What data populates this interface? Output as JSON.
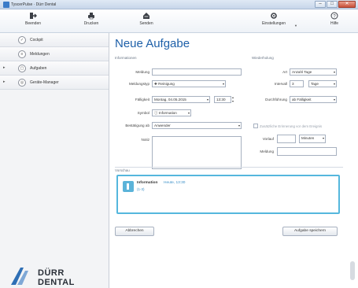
{
  "window": {
    "title": "TyscerPulse · Dürr Dental"
  },
  "toolbar": {
    "beenden": "Beenden",
    "drucken": "Drucken",
    "senden": "Senden",
    "einstellungen": "Einstellungen",
    "hilfe": "Hilfe"
  },
  "sidebar": {
    "items": [
      {
        "label": "Cockpit",
        "expandable": false
      },
      {
        "label": "Meldungen",
        "expandable": false
      },
      {
        "label": "Aufgaben",
        "expandable": true
      },
      {
        "label": "Geräte-Manager",
        "expandable": true
      }
    ]
  },
  "logo": {
    "line1": "DÜRR",
    "line2": "DENTAL"
  },
  "main": {
    "title": "Neue Aufgabe",
    "sections": {
      "info": "Informationen",
      "repeat": "Wiederholung",
      "preview": "Vorschau"
    },
    "form": {
      "meldung_label": "Meldung",
      "meldung_value": "",
      "meldungstyp_label": "Meldungstyp",
      "meldungstyp_value": "✚ Reinigung",
      "faelligkeit_label": "Fälligkeit",
      "faelligkeit_date": "Montag, 04.05.2015",
      "faelligkeit_time": "13:30",
      "symbol_label": "Symbol",
      "symbol_value": "ⓘ Information",
      "bestaetigung_label": "Bestätigung ab",
      "bestaetigung_value": "Anwender",
      "notiz_label": "Notiz"
    },
    "repeat": {
      "art_label": "Art",
      "art_value": "Anzahl Tage",
      "intervall_label": "Intervall",
      "intervall_value": "3",
      "intervall_unit": "Tage",
      "durchfuehrung_label": "Durchführung",
      "durchfuehrung_value": "ab Fälligkeit",
      "reminder_label": "Zusätzliche Erinnerung vor dem Ereignis",
      "vorlauf_label": "Vorlauf",
      "vorlauf_value": "",
      "vorlauf_unit": "Minuten",
      "rep_meldung_label": "Meldung",
      "rep_meldung_value": ""
    },
    "preview": {
      "title": "Information",
      "time": "Heute, 13:30",
      "line": "(1-3)"
    },
    "buttons": {
      "cancel": "Abbrechen",
      "save": "Aufgabe speichern"
    }
  }
}
